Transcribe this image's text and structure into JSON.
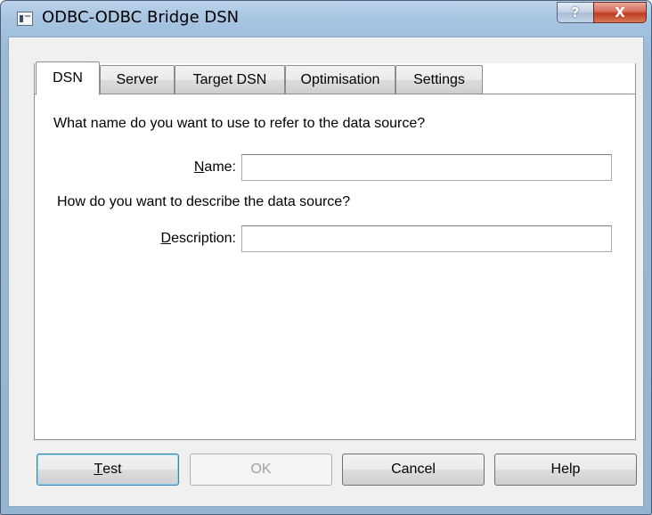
{
  "window": {
    "title": "ODBC-ODBC Bridge DSN",
    "icon": "app-window-icon",
    "help_glyph": "?",
    "close_glyph": "X"
  },
  "tabs": [
    {
      "label": "DSN",
      "active": true
    },
    {
      "label": "Server"
    },
    {
      "label": "Target DSN"
    },
    {
      "label": "Optimisation"
    },
    {
      "label": "Settings"
    }
  ],
  "dsn": {
    "name_prompt": "What name do you want to use to refer to the data source?",
    "name_label_mnemonic": "N",
    "name_label_rest": "ame:",
    "name_value": "",
    "description_prompt": "How do you want to describe the data source?",
    "description_label_mnemonic": "D",
    "description_label_rest": "escription:",
    "description_value": ""
  },
  "buttons": {
    "test_mnemonic": "T",
    "test_rest": "est",
    "ok": "OK",
    "cancel": "Cancel",
    "help": "Help"
  },
  "colors": {
    "frame": "#9ebfde",
    "close": "#c0391f",
    "panel": "#ffffff",
    "dialog_face": "#f0f0f0"
  }
}
